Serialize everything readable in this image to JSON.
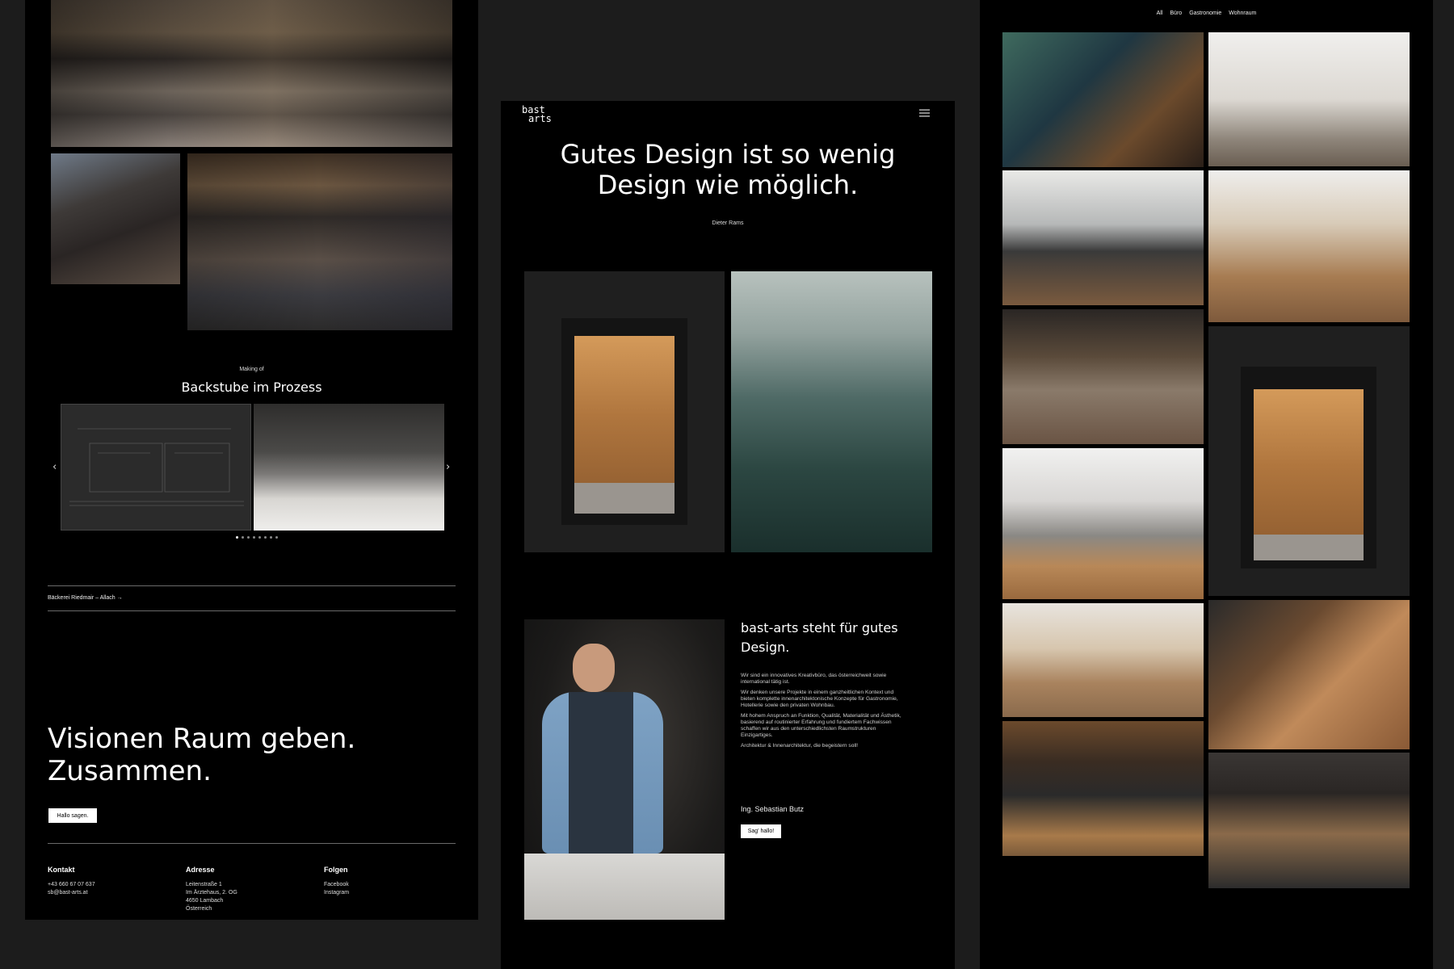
{
  "left": {
    "making_of": "Making of",
    "backstube_title": "Backstube im Prozess",
    "prev_arrow": "‹",
    "next_arrow": "›",
    "project_link": "Bäckerei Riedmair – Allach →",
    "headline_line1": "Visionen Raum geben.",
    "headline_line2": "Zusammen.",
    "hello_button": "Hallo sagen.",
    "footer": {
      "kontakt_title": "Kontakt",
      "kontakt_phone": "+43 660 67 07 637",
      "kontakt_email": "sb@bast-arts.at",
      "adresse_title": "Adresse",
      "adresse_line1": "Leitenstraße 1",
      "adresse_line2": "Im Ärztehaus, 2. OG",
      "adresse_line3": "4650 Lambach",
      "adresse_line4": "Österreich",
      "folgen_title": "Folgen",
      "folgen_facebook": "Facebook",
      "folgen_instagram": "Instagram"
    }
  },
  "middle": {
    "logo_line1": "bast",
    "logo_line2": "arts",
    "quote_line1": "Gutes Design ist so wenig",
    "quote_line2": "Design wie möglich.",
    "quote_author": "Dieter Rams",
    "about_title_line1": "bast-arts steht für gutes",
    "about_title_line2": "Design.",
    "para1": "Wir sind ein innovatives Kreativbüro, das österreichweit sowie international tätig ist.",
    "para2": "Wir denken unsere Projekte in einem ganzheitlichen Kontext und bieten komplette innenarchitektonische Konzepte für Gastronomie, Hotellerie sowie den privaten Wohnbau.",
    "para3": "Mit hohem Anspruch an Funktion, Qualität, Materialität und Ästhetik, basierend auf routinierter Erfahrung und fundiertem Fachwissen schaffen wir aus den unterschiedlichsten Raumstrukturen Einzigartiges.",
    "para4": "Architektur & Innenarchitektur, die begeistern soll!",
    "signature": "Ing. Sebastian Butz",
    "say_hello_button": "Sag' hallo!"
  },
  "right": {
    "filters": [
      "All",
      "Büro",
      "Gastronomie",
      "Wohnraum"
    ]
  },
  "colors": {
    "background": "#1c1c1c",
    "panel": "#000000",
    "button_bg": "#ffffff"
  },
  "icons": {
    "menu": "hamburger-menu-icon",
    "prev": "chevron-left-icon",
    "next": "chevron-right-icon"
  }
}
